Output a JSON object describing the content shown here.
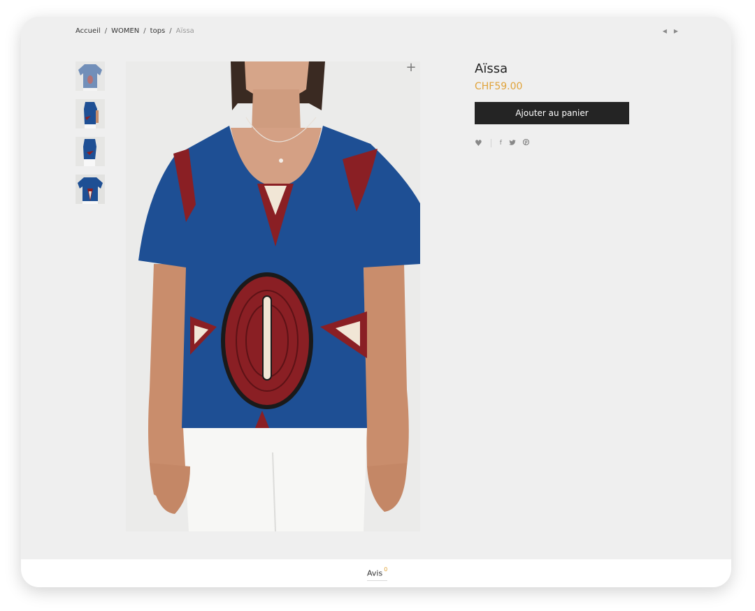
{
  "breadcrumb": {
    "items": [
      "Accueil",
      "WOMEN",
      "tops"
    ],
    "current": "Aïssa",
    "separator": "/"
  },
  "navigation": {
    "prev_icon": "triangle-left-icon",
    "next_icon": "triangle-right-icon"
  },
  "product": {
    "title": "Aïssa",
    "price": "CHF59.00",
    "add_to_cart_label": "Ajouter au panier"
  },
  "gallery": {
    "thumbnail_count": 4,
    "zoom_symbol": "+"
  },
  "social": {
    "icons": [
      "heart-icon",
      "facebook-icon",
      "twitter-icon",
      "pinterest-icon"
    ],
    "facebook_glyph": "f",
    "twitter_glyph": "🐦",
    "pinterest_glyph": "℗"
  },
  "tabs": {
    "reviews_label": "Avis",
    "reviews_count": "0"
  },
  "colors": {
    "accent": "#e0a33a",
    "button_bg": "#242424",
    "shirt_blue": "#1e4f94",
    "pattern_red": "#8a1f24"
  }
}
